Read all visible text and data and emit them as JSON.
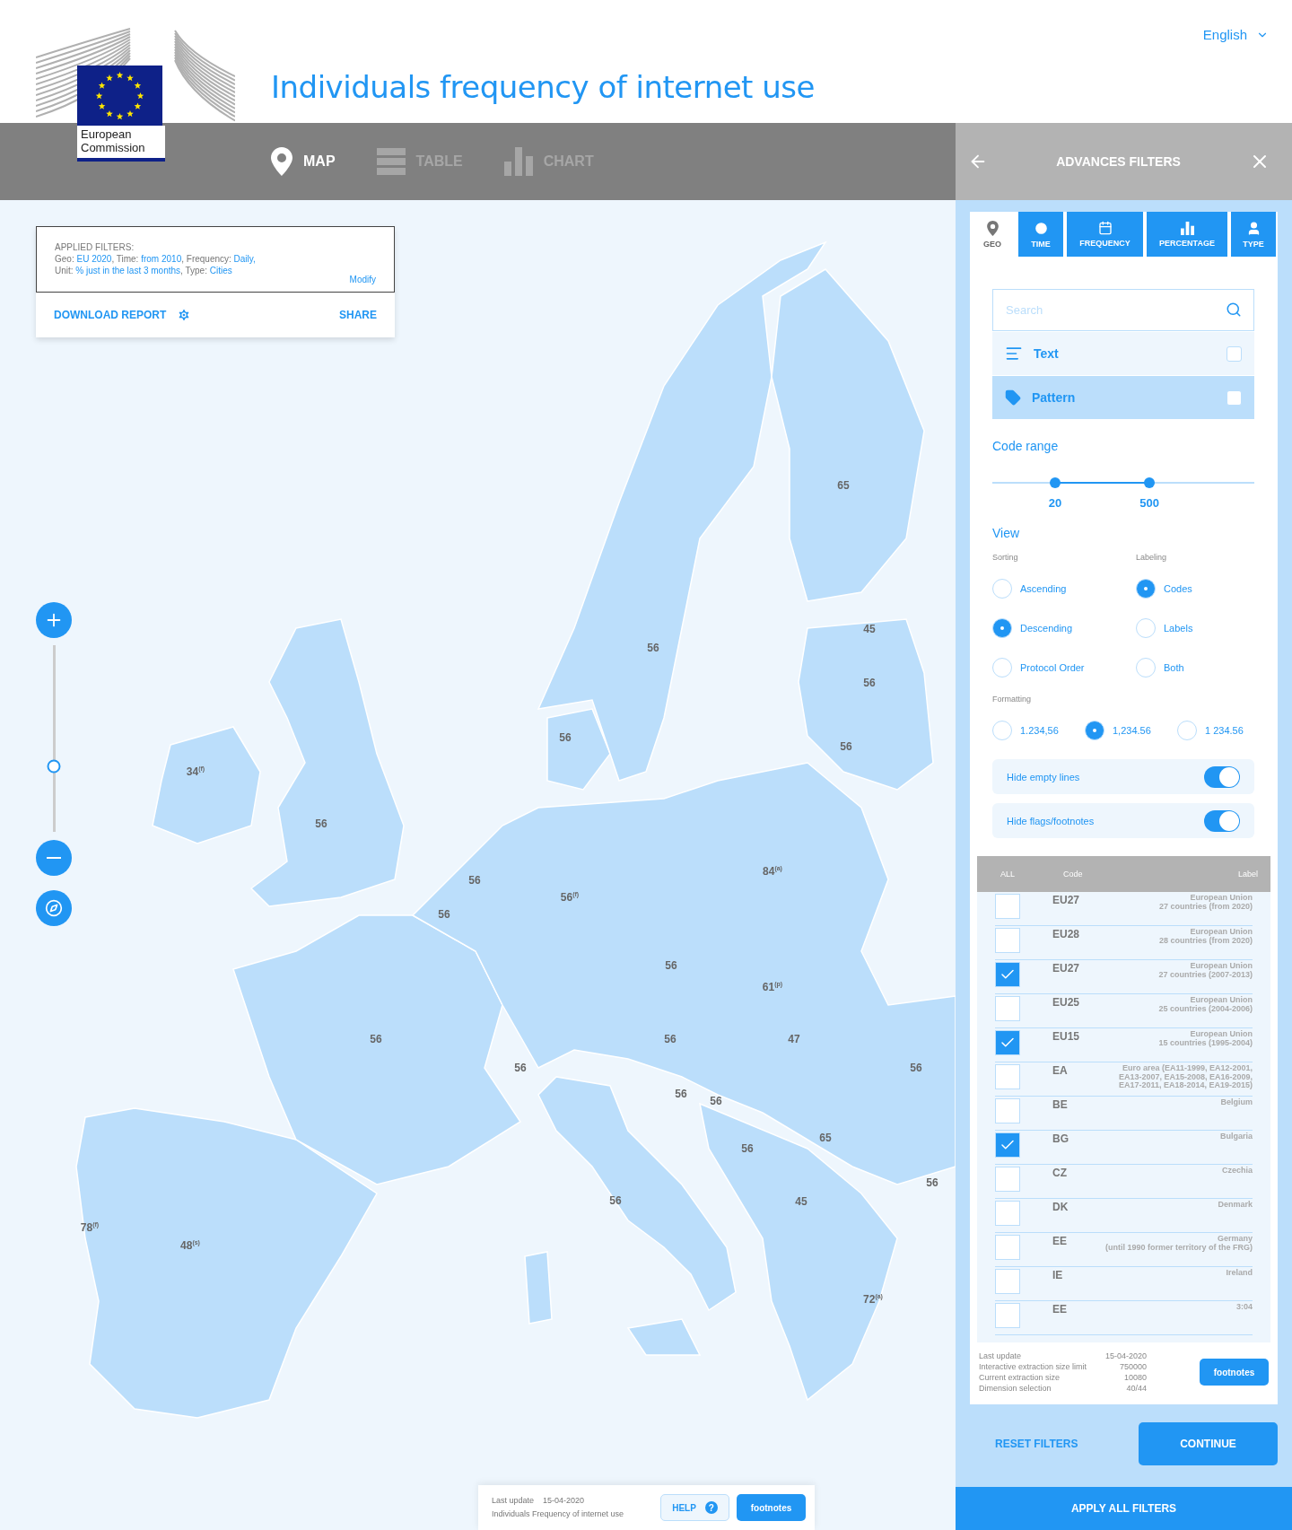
{
  "header": {
    "logo_text": "European Commission",
    "title": "Individuals frequency of internet use",
    "language": "English"
  },
  "view_tabs": [
    {
      "label": "MAP",
      "kind": "map",
      "selected": true
    },
    {
      "label": "TABLE",
      "kind": "table",
      "selected": false
    },
    {
      "label": "CHART",
      "kind": "chart",
      "selected": false
    }
  ],
  "applied_filters": {
    "heading": "APPLIED FILTERS:",
    "lines": [
      [
        {
          "text": "Geo: ",
          "link": false
        },
        {
          "text": "EU 2020",
          "link": true
        },
        {
          "text": ", Time: ",
          "link": false
        },
        {
          "text": "from 2010",
          "link": true
        },
        {
          "text": ", Frequency: ",
          "link": false
        },
        {
          "text": "Daily,",
          "link": true
        }
      ],
      [
        {
          "text": "Unit: ",
          "link": false
        },
        {
          "text": "% just in the last 3 months",
          "link": true
        },
        {
          "text": ", Type: ",
          "link": false
        },
        {
          "text": "Cities",
          "link": true
        }
      ]
    ],
    "modify": "Modify",
    "download": "DOWNLOAD REPORT",
    "share": "SHARE"
  },
  "map": {
    "zoom": {
      "level": 0.35
    },
    "labels": [
      "65",
      "56",
      "45",
      "56",
      "56",
      "56",
      "34$^{(f)}$",
      "56",
      "56",
      "56",
      "56$^{(f)}$",
      "84$^{(a)}$",
      "56",
      "61$^{(p)}$",
      "56",
      "56",
      "47",
      "56",
      "56",
      "56",
      "56",
      "65",
      "56",
      "56",
      "45",
      "56",
      "78$^{(f)}$",
      "48$^{(s)}$",
      "72$^{(a)}$"
    ]
  },
  "footer": {
    "last_update_label": "Last update",
    "last_update": "15-04-2020",
    "dataset": "Individuals Frequency of internet use",
    "help": "HELP",
    "help_icon": "?",
    "footnotes": "footnotes"
  },
  "panel": {
    "title": "ADVANCES FILTERS",
    "tabs": [
      {
        "label": "GEO",
        "kind": "geo",
        "selected": true
      },
      {
        "label": "TIME",
        "kind": "time",
        "selected": false
      },
      {
        "label": "FREQUENCY",
        "kind": "frequency",
        "selected": false
      },
      {
        "label": "PERCENTAGE",
        "kind": "percentage",
        "selected": false
      },
      {
        "label": "TYPE",
        "kind": "type",
        "selected": false
      }
    ],
    "search": {
      "placeholder": "Search"
    },
    "match_modes": [
      {
        "label": "Text",
        "kind": "text",
        "selected": false,
        "checked": false
      },
      {
        "label": "Pattern",
        "kind": "pattern",
        "selected": true,
        "checked": false
      }
    ],
    "code_range": {
      "title": "Code range",
      "min": {
        "level": 0.24,
        "value": "20"
      },
      "max": {
        "level": 0.6,
        "value": "500"
      }
    },
    "view": {
      "title": "View",
      "sorting": {
        "title": "Sorting",
        "options": [
          {
            "label": "Ascending",
            "selected": false
          },
          {
            "label": "Descending",
            "selected": true
          },
          {
            "label": "Protocol Order",
            "selected": false
          }
        ]
      },
      "labeling": {
        "title": "Labeling",
        "options": [
          {
            "label": "Codes",
            "selected": true
          },
          {
            "label": "Labels",
            "selected": false
          },
          {
            "label": "Both",
            "selected": false
          }
        ]
      },
      "formatting": {
        "title": "Formatting",
        "options": [
          {
            "label": "1.234,56",
            "selected": false
          },
          {
            "label": "1,234.56",
            "selected": true
          },
          {
            "label": "1 234.56",
            "selected": false
          }
        ]
      },
      "toggles": [
        {
          "label": "Hide empty lines",
          "on": true
        },
        {
          "label": "Hide flags/footnotes",
          "on": true
        }
      ]
    },
    "table": {
      "columns": [
        "ALL",
        "Code",
        "Label"
      ],
      "rows": [
        {
          "checked": false,
          "code": "EU27",
          "label": "European Union\n27 countries (from 2020)"
        },
        {
          "checked": false,
          "code": "EU28",
          "label": "European Union\n28 countries (from 2020)"
        },
        {
          "checked": true,
          "code": "EU27",
          "label": "European Union\n27 countries (2007-2013)"
        },
        {
          "checked": false,
          "code": "EU25",
          "label": "European Union\n25 countries (2004-2006)"
        },
        {
          "checked": true,
          "code": "EU15",
          "label": "European Union\n15 countries (1995-2004)"
        },
        {
          "checked": false,
          "code": "EA",
          "label": "Euro area (EA11-1999, EA12-2001,\nEA13-2007, EA15-2008, EA16-2009,\nEA17-2011, EA18-2014, EA19-2015)"
        },
        {
          "checked": false,
          "code": "BE",
          "label": "Belgium"
        },
        {
          "checked": true,
          "code": "BG",
          "label": "Bulgaria"
        },
        {
          "checked": false,
          "code": "CZ",
          "label": "Czechia"
        },
        {
          "checked": false,
          "code": "DK",
          "label": "Denmark"
        },
        {
          "checked": false,
          "code": "EE",
          "label": "Germany\n(until 1990 former territory of the FRG)"
        },
        {
          "checked": false,
          "code": "IE",
          "label": "Ireland"
        },
        {
          "checked": false,
          "code": "EE",
          "label": "3:04"
        }
      ]
    },
    "info": [
      {
        "label": "Last update",
        "value": "15-04-2020"
      },
      {
        "label": "Interactive extraction size limit",
        "value": "750000"
      },
      {
        "label": "Current extraction size",
        "value": "10080"
      },
      {
        "label": "Dimension selection",
        "value": "40/44"
      }
    ],
    "footnotes": "footnotes",
    "reset": "RESET FILTERS",
    "continue": "CONTINUE",
    "apply": "APPLY ALL FILTERS"
  }
}
